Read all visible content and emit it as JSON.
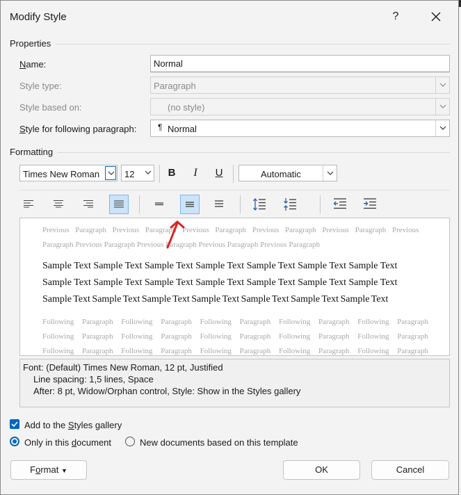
{
  "window": {
    "title": "Modify Style",
    "help_glyph": "?"
  },
  "properties": {
    "section_label": "Properties",
    "name_label": "Name:",
    "name_value": "Normal",
    "style_type_label": "Style type:",
    "style_type_value": "Paragraph",
    "style_based_on_label": "Style based on:",
    "style_based_on_value": "(no style)",
    "following_label": "Style for following paragraph:",
    "following_value": "Normal",
    "following_glyph": "¶"
  },
  "formatting": {
    "section_label": "Formatting",
    "font_name": "Times New Roman",
    "font_size": "12",
    "bold": "B",
    "italic": "I",
    "underline": "U",
    "color_value": "Automatic",
    "active_alignment": "justify",
    "active_spacing": "1.5"
  },
  "preview": {
    "previous_lines": [
      "Previous Paragraph Previous Paragraph Previous Paragraph Previous Paragraph Previous Paragraph Previous",
      "Paragraph Previous Paragraph Previous Paragraph Previous Paragraph Previous Paragraph"
    ],
    "sample_lines": [
      "Sample Text Sample Text Sample Text Sample Text Sample Text Sample Text Sample Text",
      "Sample Text Sample Text Sample Text Sample Text Sample Text Sample Text Sample Text",
      "Sample Text Sample Text Sample Text Sample Text Sample Text Sample Text Sample Text"
    ],
    "following_lines": [
      "Following Paragraph Following Paragraph Following Paragraph Following Paragraph Following Paragraph",
      "Following Paragraph Following Paragraph Following Paragraph Following Paragraph Following Paragraph",
      "Following Paragraph Following Paragraph Following Paragraph Following Paragraph Following Paragraph"
    ]
  },
  "description": {
    "line1": "Font: (Default) Times New Roman, 12 pt, Justified",
    "line2": "Line spacing:  1,5 lines, Space",
    "line3": "After:  8 pt, Widow/Orphan control, Style: Show in the Styles gallery"
  },
  "options": {
    "add_to_gallery": "Add to the Styles gallery",
    "add_to_gallery_checked": true,
    "only_this_document": "Only in this document",
    "new_documents": "New documents based on this template",
    "selected_scope": "only_this_document"
  },
  "buttons": {
    "format": "Format",
    "ok": "OK",
    "cancel": "Cancel"
  },
  "colors": {
    "accent": "#0067c0",
    "annotation_arrow": "#e02020",
    "active_button_fill": "#cce4f7"
  }
}
